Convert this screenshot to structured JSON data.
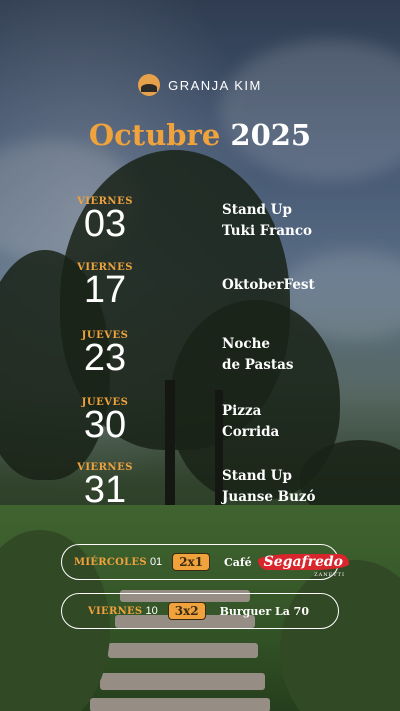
{
  "brand": {
    "name": "GRANJA KIM"
  },
  "header": {
    "month": "Octubre",
    "year": "2025"
  },
  "events": [
    {
      "day_name": "VIERNES",
      "day_number": "03",
      "lines": [
        "Stand Up",
        "Tuki Franco"
      ]
    },
    {
      "day_name": "VIERNES",
      "day_number": "17",
      "lines": [
        "OktoberFest"
      ]
    },
    {
      "day_name": "JUEVES",
      "day_number": "23",
      "lines": [
        "Noche",
        "de Pastas"
      ]
    },
    {
      "day_name": "JUEVES",
      "day_number": "30",
      "lines": [
        "Pizza",
        "Corrida"
      ]
    },
    {
      "day_name": "VIERNES",
      "day_number": "31",
      "lines": [
        "Stand Up",
        "Juanse Buzó"
      ]
    }
  ],
  "promos": [
    {
      "day_name": "MIÉRCOLES",
      "day_number": "01",
      "deal": "2x1",
      "item": "Café",
      "brand_logo": "Segafredo",
      "brand_sub": "ZANETTI"
    },
    {
      "day_name": "VIERNES",
      "day_number": "10",
      "deal": "3x2",
      "item": "Burguer La 70"
    }
  ],
  "colors": {
    "accent": "#f0a33c",
    "text": "#ffffff"
  }
}
